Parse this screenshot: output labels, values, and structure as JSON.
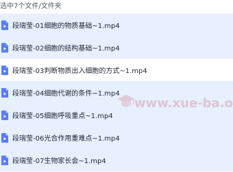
{
  "header": {
    "selection_text": "选中7个文件/文件夹"
  },
  "files": [
    {
      "name": "段瑞莹-01细胞的物质基础~1.mp4"
    },
    {
      "name": "段瑞莹-02细胞的结构基础~1.mp4"
    },
    {
      "name": "段瑞莹-03判断物质出入细胞的方式~1.mp4"
    },
    {
      "name": "段瑞莹-04细胞代谢的条件~1.mp4"
    },
    {
      "name": "段瑞莹-05细胞呼吸重点~1.mp4"
    },
    {
      "name": "段瑞莹-06光合作用重难点~1.mp4"
    },
    {
      "name": "段瑞莹-07生物家长会~1.mp4"
    }
  ],
  "watermark": {
    "text": "www.xue-ba.org"
  },
  "colors": {
    "selected_row": "#e6f0ff",
    "icon_blue": "#5b7cf7",
    "watermark": "#d2505a"
  },
  "icons": {
    "file": "video-file-icon",
    "watermark_logo": "graduation-cap-icon"
  }
}
